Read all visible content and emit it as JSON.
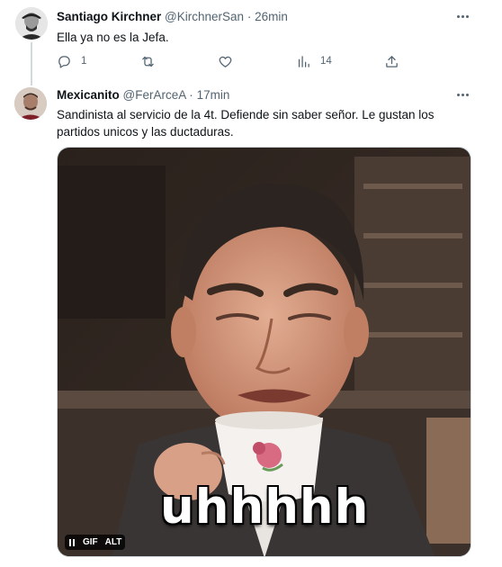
{
  "tweets": [
    {
      "name": "Santiago Kirchner",
      "handle": "@KirchnerSan",
      "separator": "·",
      "time": "26min",
      "text": "Ella ya no es la Jefa.",
      "actions": {
        "reply_count": "1",
        "retweet_count": "",
        "like_count": "",
        "view_count": "14"
      }
    },
    {
      "name": "Mexicanito",
      "handle": "@FerArceA",
      "separator": "·",
      "time": "17min",
      "text_line1": "Sandinista al servicio de la 4t. Defiende sin saber señor. Le gustan los",
      "text_line2": "partidos unicos y las ductaduras.",
      "media": {
        "caption": "uhhhhh",
        "gif_label": "GIF",
        "alt_label": "ALT"
      }
    }
  ],
  "icons": {
    "more": "more-horizontal-icon",
    "reply": "reply-icon",
    "retweet": "retweet-icon",
    "like": "heart-icon",
    "views": "views-icon",
    "share": "share-icon",
    "pause": "pause-icon"
  },
  "colors": {
    "text_primary": "#0f1419",
    "text_secondary": "#536471",
    "border": "#cfd9de"
  }
}
